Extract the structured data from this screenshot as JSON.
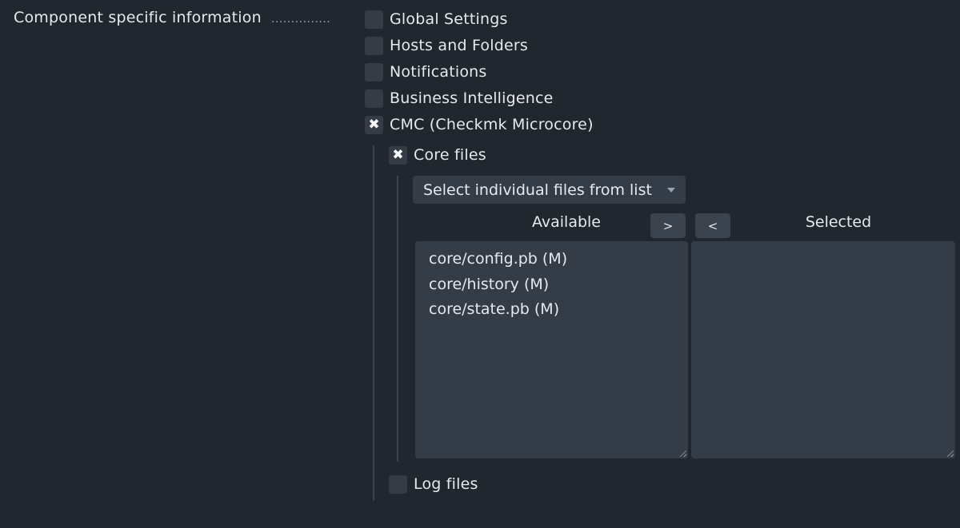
{
  "section": {
    "label": "Component specific information",
    "dots": "..............."
  },
  "components": [
    {
      "label": "Global Settings",
      "checked": false
    },
    {
      "label": "Hosts and Folders",
      "checked": false
    },
    {
      "label": "Notifications",
      "checked": false
    },
    {
      "label": "Business Intelligence",
      "checked": false
    },
    {
      "label": "CMC (Checkmk Microcore)",
      "checked": true
    }
  ],
  "cmc": {
    "core_files": {
      "label": "Core files",
      "checked": true
    },
    "selector": {
      "value": "Select individual files from list"
    },
    "dualist": {
      "available_label": "Available",
      "selected_label": "Selected",
      "add_label": ">",
      "remove_label": "<",
      "available": [
        "core/config.pb (M)",
        "core/history (M)",
        "core/state.pb (M)"
      ],
      "selected": []
    },
    "log_files": {
      "label": "Log files",
      "checked": false
    }
  },
  "checkmark_glyph": "✖"
}
